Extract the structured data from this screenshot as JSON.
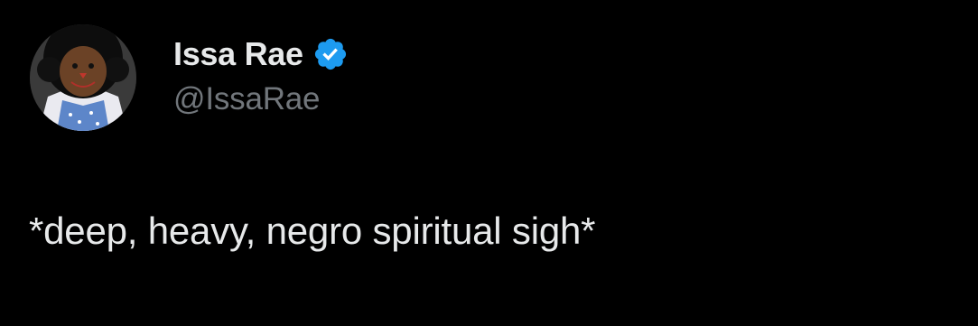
{
  "author": {
    "display_name": "Issa Rae",
    "handle": "@IssaRae",
    "verified": true,
    "verified_badge_color": "#1d9bf0"
  },
  "tweet": {
    "text": "*deep, heavy, negro spiritual sigh*"
  },
  "theme": {
    "background": "#000000",
    "primary_text": "#e7e9ea",
    "secondary_text": "#71767b"
  },
  "icons": {
    "verified": "verified-badge-icon",
    "avatar": "ragdoll-avatar"
  }
}
